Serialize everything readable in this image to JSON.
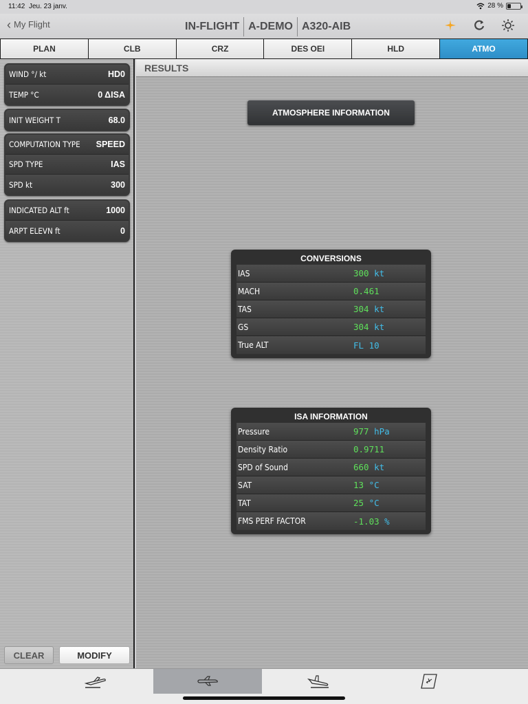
{
  "status": {
    "time": "11:42",
    "date": "Jeu. 23 janv.",
    "battery": "28 %"
  },
  "nav": {
    "back": "My Flight",
    "titles": [
      "IN-FLIGHT",
      "A-DEMO",
      "A320-AIB"
    ],
    "icons": [
      "plane-crosshair-icon",
      "refresh-icon",
      "brightness-icon"
    ],
    "accent": "#f5a623"
  },
  "tabs": [
    "PLAN",
    "CLB",
    "CRZ",
    "DES OEI",
    "HLD",
    "ATMO"
  ],
  "active_tab": "ATMO",
  "params": {
    "wind": {
      "label": "WIND °/ kt",
      "value": "HD0"
    },
    "temp": {
      "label": "TEMP °C",
      "value": "0 ΔISA"
    },
    "init_weight": {
      "label": "INIT WEIGHT  T",
      "value": "68.0"
    },
    "computation_type": {
      "label": "COMPUTATION TYPE",
      "value": "SPEED"
    },
    "spd_type": {
      "label": "SPD TYPE",
      "value": "IAS"
    },
    "spd": {
      "label": "SPD  kt",
      "value": "300"
    },
    "indicated_alt": {
      "label": "INDICATED ALT  ft",
      "value": "1000"
    },
    "arpt_elevn": {
      "label": "ARPT ELEVN  ft",
      "value": "0"
    }
  },
  "buttons": {
    "clear": "CLEAR",
    "modify": "MODIFY"
  },
  "results": {
    "header": "RESULTS",
    "atmo_button": "ATMOSPHERE INFORMATION",
    "conversions": {
      "title": "CONVERSIONS",
      "rows": [
        {
          "label": "IAS",
          "value": "300",
          "unit": "kt"
        },
        {
          "label": "MACH",
          "value": "0.461",
          "unit": ""
        },
        {
          "label": "TAS",
          "value": "304",
          "unit": "kt"
        },
        {
          "label": "GS",
          "value": "304",
          "unit": "kt"
        },
        {
          "label": "True ALT",
          "value": "",
          "unit": "FL 10"
        }
      ]
    },
    "isa": {
      "title": "ISA INFORMATION",
      "rows": [
        {
          "label": "Pressure",
          "value": "977",
          "unit": "hPa"
        },
        {
          "label": "Density Ratio",
          "value": "0.9711",
          "unit": ""
        },
        {
          "label": "SPD of Sound",
          "value": "660",
          "unit": "kt"
        },
        {
          "label": "SAT",
          "value": "13",
          "unit": "°C"
        },
        {
          "label": "TAT",
          "value": "25",
          "unit": "°C"
        },
        {
          "label": "FMS PERF FACTOR",
          "value": "-1.03",
          "unit": "%"
        }
      ]
    }
  },
  "bottom_tabs": [
    "takeoff-icon",
    "cruise-icon",
    "landing-icon",
    "document-plane-icon"
  ],
  "colors": {
    "tab_active": "#3a9fd8",
    "value_green": "#5fe05b",
    "unit_blue": "#42bde8"
  }
}
